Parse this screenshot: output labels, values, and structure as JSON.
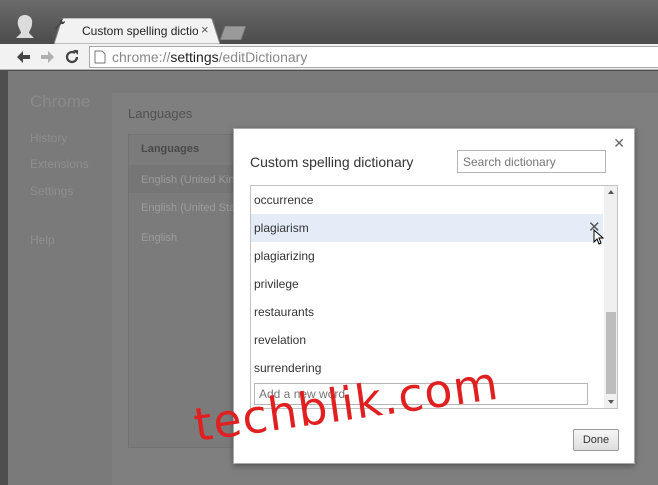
{
  "browser": {
    "tab_title": "Custom spelling dictionar",
    "url_scheme": "chrome://",
    "url_host": "settings",
    "url_path": "/editDictionary"
  },
  "settings_background": {
    "title": "Chrome",
    "nav": [
      "History",
      "Extensions",
      "Settings",
      "Help"
    ],
    "languages_heading": "Languages",
    "languages_list_header": "Languages",
    "languages": [
      "English (United Kin",
      "English (United Stat",
      "English"
    ]
  },
  "dialog": {
    "title": "Custom spelling dictionary",
    "search_placeholder": "Search dictionary",
    "words": [
      "occurrence",
      "plagiarism",
      "plagiarizing",
      "privilege",
      "restaurants",
      "revelation",
      "surrendering"
    ],
    "highlighted_word": "plagiarism",
    "add_placeholder": "Add a new word",
    "done_label": "Done"
  },
  "watermark": "techblik.com",
  "colors": {
    "highlight": "#e4ecf7",
    "watermark": "#e02020"
  }
}
